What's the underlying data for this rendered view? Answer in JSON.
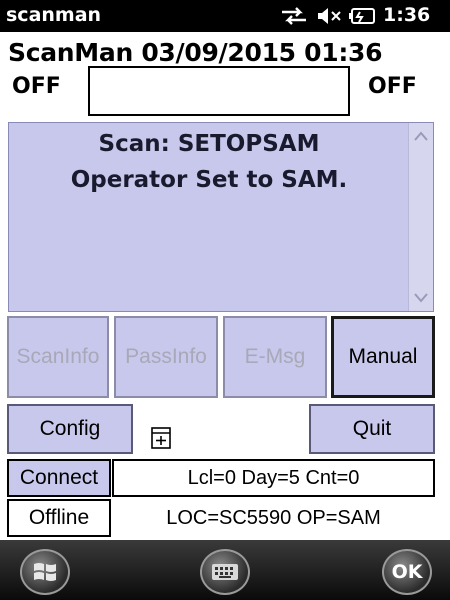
{
  "status_bar": {
    "title": "scanman",
    "time": "1:36",
    "icons": [
      "network-sync-icon",
      "speaker-icon",
      "battery-icon"
    ]
  },
  "header": {
    "title": "ScanMan 03/09/2015 01:36",
    "left_status": "OFF",
    "right_status": "OFF",
    "input_value": ""
  },
  "message": {
    "lines": [
      "Scan: SETOPSAM",
      "Operator Set to SAM."
    ]
  },
  "buttons": {
    "scaninfo": "ScanInfo",
    "passinfo": "PassInfo",
    "emsg": "E-Msg",
    "manual": "Manual",
    "config": "Config",
    "quit": "Quit",
    "connect": "Connect",
    "offline": "Offline"
  },
  "info": {
    "counts": "Lcl=0 Day=5 Cnt=0",
    "location": "LOC=SC5590  OP=SAM"
  },
  "bottom_bar": {
    "ok_label": "OK",
    "icons": [
      "windows-start-icon",
      "keyboard-icon"
    ]
  },
  "colors": {
    "panel": "#c8c8ec",
    "status_bar": "#000000",
    "disabled_text": "#a8a8b8"
  }
}
